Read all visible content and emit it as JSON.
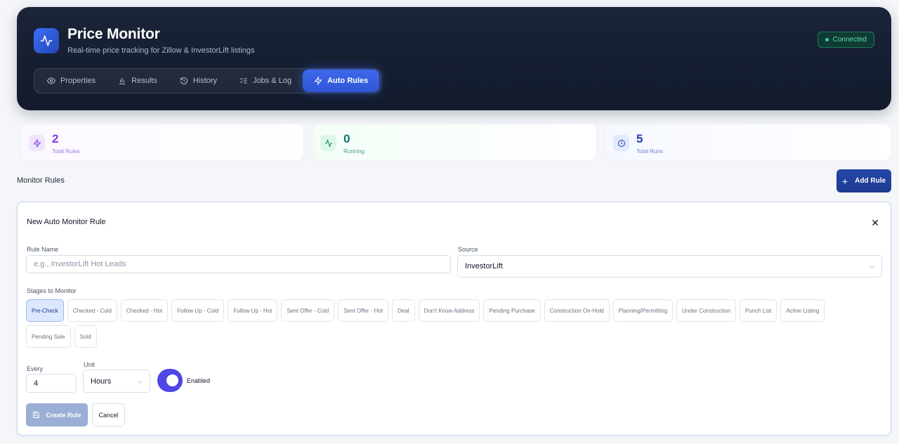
{
  "app": {
    "title": "Price Monitor",
    "subtitle": "Real-time price tracking for Zillow & InvestorLift listings",
    "status": "Connected"
  },
  "tabs": [
    {
      "label": "Properties",
      "icon": "eye-icon"
    },
    {
      "label": "Results",
      "icon": "bar-chart-icon"
    },
    {
      "label": "History",
      "icon": "history-icon"
    },
    {
      "label": "Jobs & Log",
      "icon": "list-checks-icon"
    },
    {
      "label": "Auto Rules",
      "icon": "zap-icon",
      "active": true
    }
  ],
  "stats": {
    "total_rules": {
      "value": "2",
      "label": "Total Rules"
    },
    "running": {
      "value": "0",
      "label": "Running"
    },
    "total_runs": {
      "value": "5",
      "label": "Total Runs"
    }
  },
  "section": {
    "title": "Monitor Rules",
    "add_button": "Add Rule"
  },
  "form": {
    "title": "New Auto Monitor Rule",
    "rule_name_label": "Rule Name",
    "rule_name_placeholder": "e.g., InvestorLift Hot Leads",
    "rule_name_value": "",
    "source_label": "Source",
    "source_value": "InvestorLift",
    "stages_label": "Stages to Monitor",
    "stages": [
      {
        "label": "Pre-Check",
        "selected": true
      },
      {
        "label": "Checked - Cold",
        "selected": false
      },
      {
        "label": "Checked - Hot",
        "selected": false
      },
      {
        "label": "Follow Up - Cold",
        "selected": false
      },
      {
        "label": "Follow Up - Hot",
        "selected": false
      },
      {
        "label": "Sent Offer - Cold",
        "selected": false
      },
      {
        "label": "Sent Offer - Hot",
        "selected": false
      },
      {
        "label": "Deal",
        "selected": false
      },
      {
        "label": "Don't Know Address",
        "selected": false
      },
      {
        "label": "Pending Purchase",
        "selected": false
      },
      {
        "label": "Construction On-Hold",
        "selected": false
      },
      {
        "label": "Planning/Permitting",
        "selected": false
      },
      {
        "label": "Under Construction",
        "selected": false
      },
      {
        "label": "Punch List",
        "selected": false
      },
      {
        "label": "Active Listing",
        "selected": false
      },
      {
        "label": "Pending Sale",
        "selected": false
      },
      {
        "label": "Sold",
        "selected": false
      }
    ],
    "every_label": "Every",
    "every_value": "4",
    "unit_label": "Unit",
    "unit_value": "Hours",
    "enabled_label": "Enabled",
    "enabled": true,
    "create_button": "Create Rule",
    "cancel_button": "Cancel"
  },
  "colors": {
    "accent": "#2f56d6",
    "header_bg": "#161e31",
    "toggle": "#4f46e5"
  }
}
